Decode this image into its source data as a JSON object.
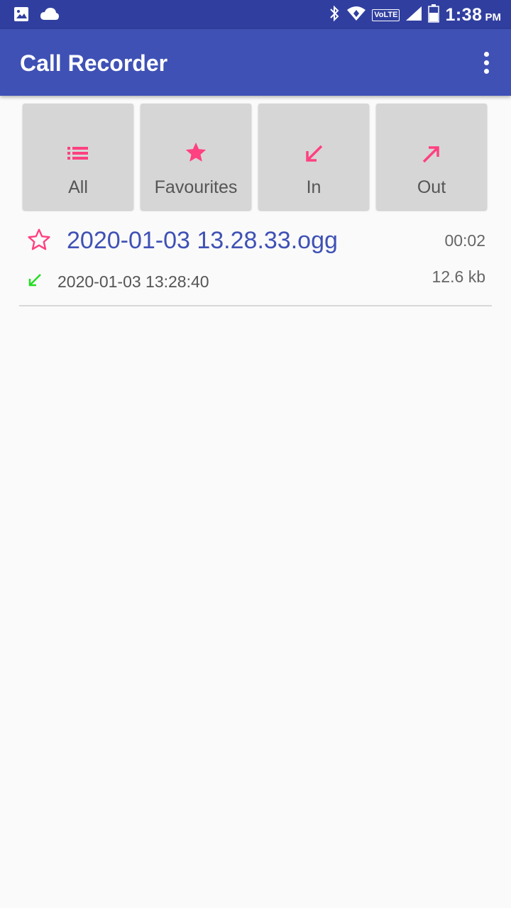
{
  "status_bar": {
    "time": "1:38",
    "ampm": "PM",
    "network_label": "VoLTE",
    "icons": [
      "image-icon",
      "cloud-icon",
      "bluetooth-icon",
      "wifi-icon",
      "volte-icon",
      "signal-icon",
      "battery-icon"
    ]
  },
  "app_bar": {
    "title": "Call Recorder",
    "overflow_icon": "more-vert-icon"
  },
  "filters": [
    {
      "label": "All",
      "icon": "list-icon"
    },
    {
      "label": "Favourites",
      "icon": "star-filled-icon"
    },
    {
      "label": "In",
      "icon": "arrow-incoming-icon"
    },
    {
      "label": "Out",
      "icon": "arrow-outgoing-icon"
    }
  ],
  "recordings": [
    {
      "name": "2020-01-03 13.28.33.ogg",
      "duration": "00:02",
      "datetime": "2020-01-03 13:28:40",
      "size": "12.6 kb",
      "direction": "incoming",
      "favourite": false
    }
  ],
  "colors": {
    "primary": "#3f51b5",
    "primary_dark": "#303f9f",
    "accent": "#ff4081",
    "incoming": "#22dd22",
    "background": "#fafafa"
  }
}
